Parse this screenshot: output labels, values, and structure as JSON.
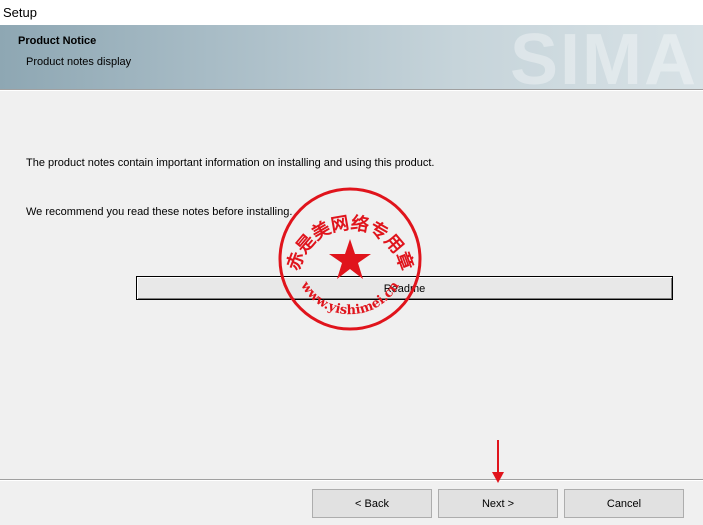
{
  "window": {
    "title": "Setup"
  },
  "banner": {
    "title": "Product Notice",
    "subtitle": "Product notes display",
    "watermark": "SIMA"
  },
  "content": {
    "line1": "The product notes contain important information on installing and using this product.",
    "line2": "We recommend you read these notes before installing.",
    "readme_label": "Readme"
  },
  "buttons": {
    "back": "< Back",
    "next": "Next >",
    "cancel": "Cancel"
  },
  "stamp": {
    "top_text": "赤是美网络专用章",
    "bottom_text": "www.yishimei.cn",
    "color": "#e0141c"
  },
  "annotation": {
    "arrow_color": "#e0141c"
  }
}
